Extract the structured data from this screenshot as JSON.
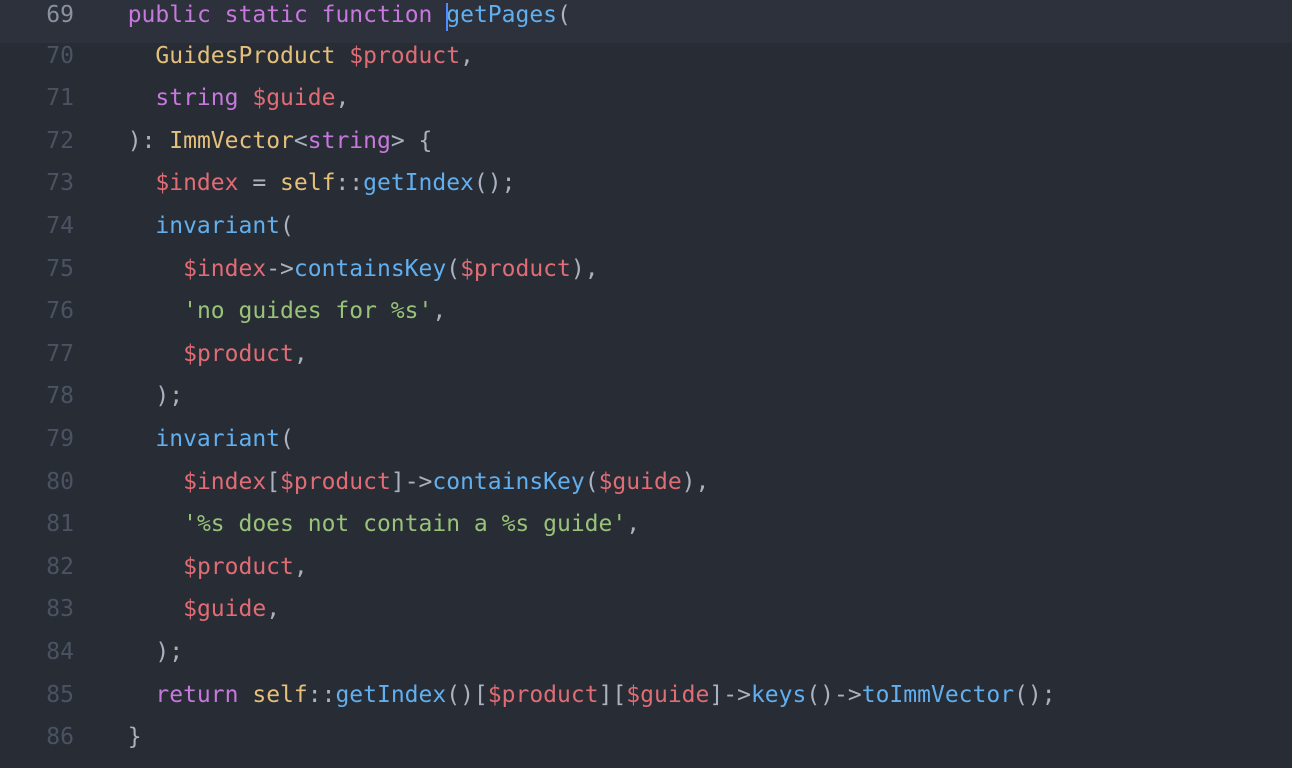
{
  "lines": {
    "l69": {
      "num": "69"
    },
    "l70": {
      "num": "70"
    },
    "l71": {
      "num": "71"
    },
    "l72": {
      "num": "72"
    },
    "l73": {
      "num": "73"
    },
    "l74": {
      "num": "74"
    },
    "l75": {
      "num": "75"
    },
    "l76": {
      "num": "76"
    },
    "l77": {
      "num": "77"
    },
    "l78": {
      "num": "78"
    },
    "l79": {
      "num": "79"
    },
    "l80": {
      "num": "80"
    },
    "l81": {
      "num": "81"
    },
    "l82": {
      "num": "82"
    },
    "l83": {
      "num": "83"
    },
    "l84": {
      "num": "84"
    },
    "l85": {
      "num": "85"
    },
    "l86": {
      "num": "86"
    }
  },
  "t": {
    "public": "public",
    "static": "static",
    "function": "function",
    "getPages": "getPages",
    "GuidesProduct": "GuidesProduct",
    "string": "string",
    "ImmVector": "ImmVector",
    "self": "self",
    "getIndex": "getIndex",
    "invariant1": "invariant",
    "invariant2": "invariant",
    "containsKey1": "containsKey",
    "containsKey2": "containsKey",
    "keys": "keys",
    "toImmVector": "toImmVector",
    "return": "return",
    "str1": "'no guides for %s'",
    "str2": "'%s does not contain a %s guide'",
    "v_product": "$product",
    "v_guide": "$guide",
    "v_index": "$index",
    "sp2": "  ",
    "sp4": "    ",
    "sp6": "      ",
    "op_arrow": "->",
    "op_sc": "::",
    "op_eq": " = ",
    "lp": "(",
    "rp": ")",
    "lb": "[",
    "rb": "]",
    "lt": "<",
    "gt": ">",
    "lc": " {",
    "rc": "}",
    "colon_sp": ": ",
    "comma": ",",
    "semi": ";",
    "rps": ");",
    "lps": "();",
    "lpr": "()",
    "sp": " "
  }
}
